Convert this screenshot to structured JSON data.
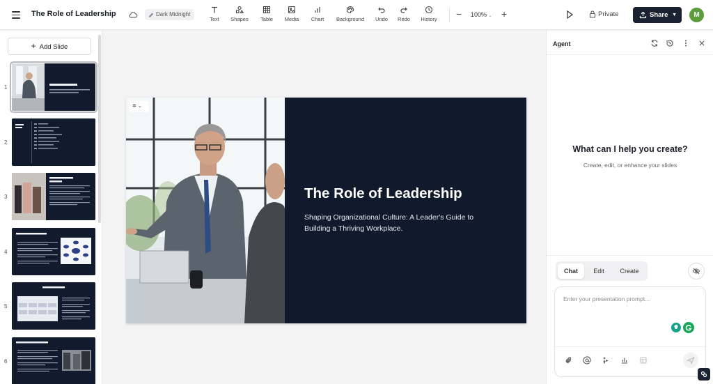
{
  "header": {
    "title": "The Role of Leadership",
    "theme_name": "Dark Midnight",
    "tools": [
      {
        "label": "Text",
        "icon": "text-icon"
      },
      {
        "label": "Shapes",
        "icon": "shapes-icon"
      },
      {
        "label": "Table",
        "icon": "table-icon"
      },
      {
        "label": "Media",
        "icon": "media-icon"
      },
      {
        "label": "Chart",
        "icon": "chart-icon"
      },
      {
        "label": "Background",
        "icon": "palette-icon"
      },
      {
        "label": "Undo",
        "icon": "undo-icon"
      },
      {
        "label": "Redo",
        "icon": "redo-icon"
      },
      {
        "label": "History",
        "icon": "history-icon"
      }
    ],
    "zoom": "100%",
    "visibility_label": "Private",
    "share_label": "Share",
    "avatar_initial": "M",
    "avatar_color": "#5c9c3a"
  },
  "sidebar": {
    "add_slide_label": "Add Slide",
    "slides": [
      {
        "number": "1",
        "active": true
      },
      {
        "number": "2"
      },
      {
        "number": "3"
      },
      {
        "number": "4"
      },
      {
        "number": "5"
      },
      {
        "number": "6"
      }
    ]
  },
  "slide": {
    "title": "The Role of Leadership",
    "subtitle": "Shaping Organizational Culture: A Leader's Guide to Building a Thriving Workplace.",
    "background": "#111a2c"
  },
  "agent": {
    "panel_title": "Agent",
    "heading": "What can I help you create?",
    "subheading": "Create, edit, or enhance your slides",
    "modes": [
      "Chat",
      "Edit",
      "Create"
    ],
    "selected_mode": "Chat",
    "prompt_placeholder": "Enter your presentation prompt..."
  },
  "colors": {
    "accent_dark": "#1a2130",
    "slide_bg": "#111a2c"
  }
}
